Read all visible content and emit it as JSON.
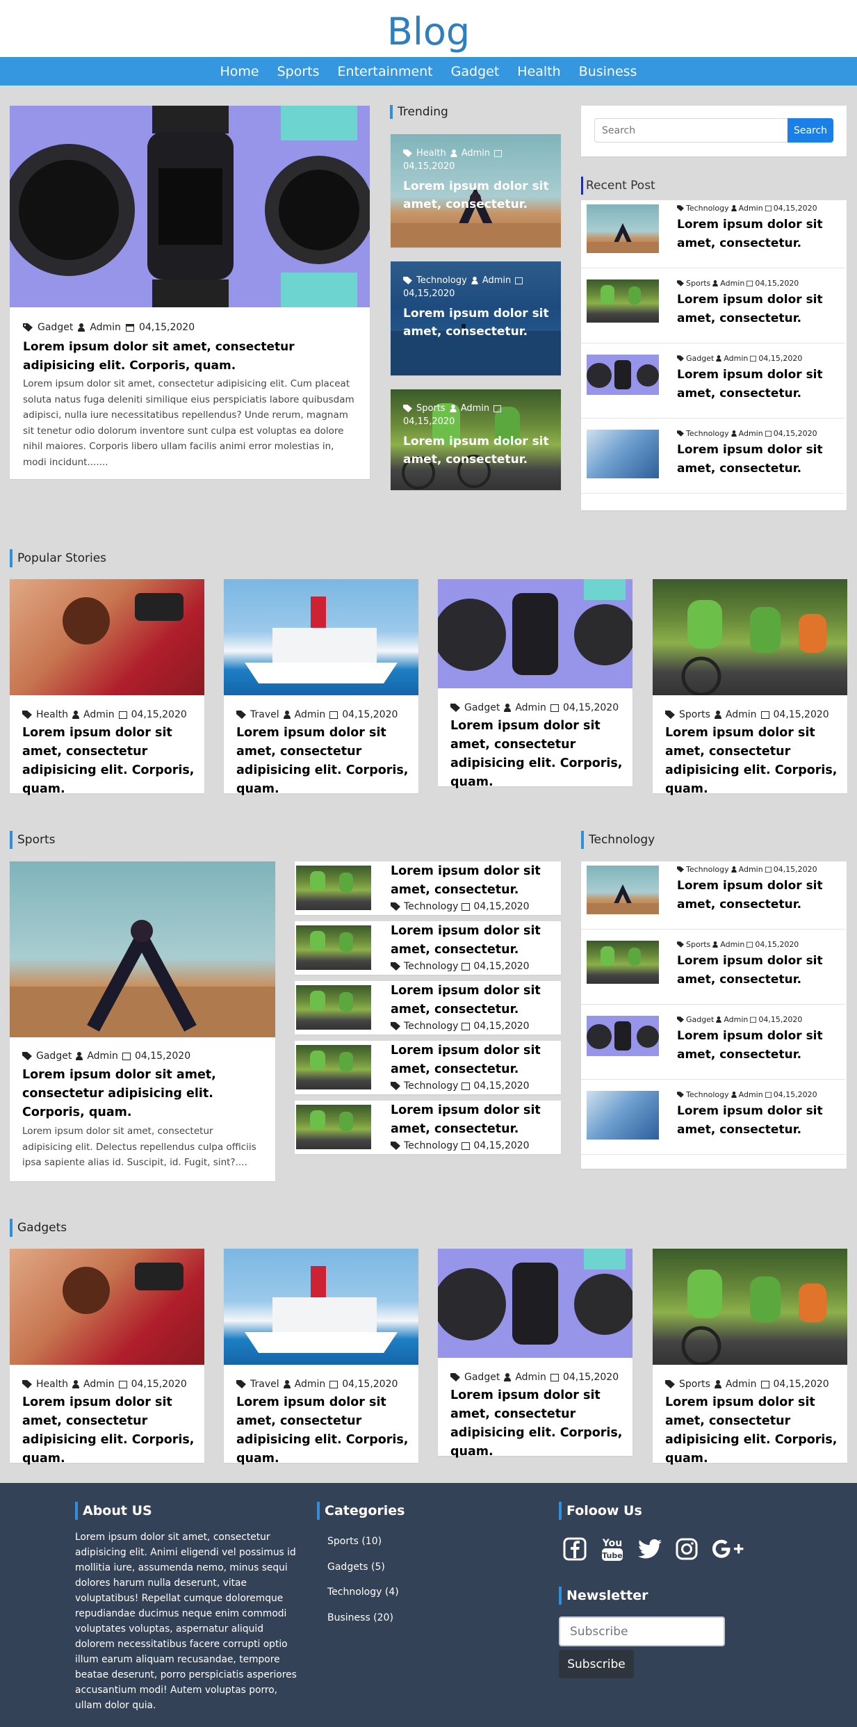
{
  "site_title": "Blog",
  "nav": [
    "Home",
    "Sports",
    "Entertainment",
    "Gadget",
    "Health",
    "Business"
  ],
  "featured": {
    "category": "Gadget",
    "author": "Admin",
    "date": "04,15,2020",
    "title": "Lorem ipsum dolor sit amet, consectetur adipisicing elit. Corporis, quam.",
    "body": "Lorem ipsum dolor sit amet, consectetur adipisicing elit. Cum placeat soluta natus fuga deleniti similique eius perspiciatis labore quibusdam adipisci, nulla iure necessitatibus repellendus? Unde rerum, magnam sit tenetur odio dolorum inventore sunt culpa est voluptas ea dolore nihil maiores. Corporis libero ullam facilis animi error molestias in, modi incidunt......."
  },
  "trending": {
    "heading": "Trending",
    "items": [
      {
        "category": "Health",
        "author": "Admin",
        "date": "04,15,2020",
        "title": "Lorem ipsum dolor sit amet, consectetur."
      },
      {
        "category": "Technology",
        "author": "Admin",
        "date": "04,15,2020",
        "title": "Lorem ipsum dolor sit amet, consectetur."
      },
      {
        "category": "Sports",
        "author": "Admin",
        "date": "04,15,2020",
        "title": "Lorem ipsum dolor sit amet, consectetur."
      }
    ]
  },
  "search": {
    "placeholder": "Search",
    "button": "Search"
  },
  "recent": {
    "heading": "Recent Post",
    "items": [
      {
        "category": "Technology",
        "author": "Admin",
        "date": "04,15,2020",
        "title": "Lorem ipsum dolor sit amet, consectetur."
      },
      {
        "category": "Sports",
        "author": "Admin",
        "date": "04,15,2020",
        "title": "Lorem ipsum dolor sit amet, consectetur."
      },
      {
        "category": "Gadget",
        "author": "Admin",
        "date": "04,15,2020",
        "title": "Lorem ipsum dolor sit amet, consectetur."
      },
      {
        "category": "Technology",
        "author": "Admin",
        "date": "04,15,2020",
        "title": "Lorem ipsum dolor sit amet, consectetur."
      }
    ]
  },
  "popular": {
    "heading": "Popular Stories",
    "items": [
      {
        "category": "Health",
        "author": "Admin",
        "date": "04,15,2020",
        "title": "Lorem ipsum dolor sit amet, consectetur adipisicing elit. Corporis, quam."
      },
      {
        "category": "Travel",
        "author": "Admin",
        "date": "04,15,2020",
        "title": "Lorem ipsum dolor sit amet, consectetur adipisicing elit. Corporis, quam."
      },
      {
        "category": "Gadget",
        "author": "Admin",
        "date": "04,15,2020",
        "title": "Lorem ipsum dolor sit amet, consectetur adipisicing elit. Corporis, quam."
      },
      {
        "category": "Sports",
        "author": "Admin",
        "date": "04,15,2020",
        "title": "Lorem ipsum dolor sit amet, consectetur adipisicing elit. Corporis, quam."
      }
    ]
  },
  "sports": {
    "heading": "Sports",
    "main": {
      "category": "Gadget",
      "author": "Admin",
      "date": "04,15,2020",
      "title": "Lorem ipsum dolor sit amet, consectetur adipisicing elit. Corporis, quam.",
      "body": "Lorem ipsum dolor sit amet, consectetur adipisicing elit. Delectus repellendus culpa officiis ipsa sapiente alias id. Suscipit, id. Fugit, sint?...."
    },
    "list": [
      {
        "category": "Technology",
        "date": "04,15,2020",
        "title": "Lorem ipsum dolor sit amet, consectetur."
      },
      {
        "category": "Technology",
        "date": "04,15,2020",
        "title": "Lorem ipsum dolor sit amet, consectetur."
      },
      {
        "category": "Technology",
        "date": "04,15,2020",
        "title": "Lorem ipsum dolor sit amet, consectetur."
      },
      {
        "category": "Technology",
        "date": "04,15,2020",
        "title": "Lorem ipsum dolor sit amet, consectetur."
      },
      {
        "category": "Technology",
        "date": "04,15,2020",
        "title": "Lorem ipsum dolor sit amet, consectetur."
      }
    ]
  },
  "technology": {
    "heading": "Technology",
    "items": [
      {
        "category": "Technology",
        "author": "Admin",
        "date": "04,15,2020",
        "title": "Lorem ipsum dolor sit amet, consectetur."
      },
      {
        "category": "Sports",
        "author": "Admin",
        "date": "04,15,2020",
        "title": "Lorem ipsum dolor sit amet, consectetur."
      },
      {
        "category": "Gadget",
        "author": "Admin",
        "date": "04,15,2020",
        "title": "Lorem ipsum dolor sit amet, consectetur."
      },
      {
        "category": "Technology",
        "author": "Admin",
        "date": "04,15,2020",
        "title": "Lorem ipsum dolor sit amet, consectetur."
      }
    ]
  },
  "gadgets": {
    "heading": "Gadgets",
    "items": [
      {
        "category": "Health",
        "author": "Admin",
        "date": "04,15,2020",
        "title": "Lorem ipsum dolor sit amet, consectetur adipisicing elit. Corporis, quam."
      },
      {
        "category": "Travel",
        "author": "Admin",
        "date": "04,15,2020",
        "title": "Lorem ipsum dolor sit amet, consectetur adipisicing elit. Corporis, quam."
      },
      {
        "category": "Gadget",
        "author": "Admin",
        "date": "04,15,2020",
        "title": "Lorem ipsum dolor sit amet, consectetur adipisicing elit. Corporis, quam."
      },
      {
        "category": "Sports",
        "author": "Admin",
        "date": "04,15,2020",
        "title": "Lorem ipsum dolor sit amet, consectetur adipisicing elit. Corporis, quam."
      }
    ]
  },
  "footer": {
    "about_heading": "About US",
    "about_text": "Lorem ipsum dolor sit amet, consectetur adipisicing elit. Animi eligendi vel possimus id mollitia iure, assumenda nemo, minus sequi dolores harum nulla deserunt, vitae voluptatibus! Repellat cumque doloremque repudiandae ducimus neque enim commodi voluptates voluptas, aspernatur aliquid dolorem necessitatibus facere corrupti optio illum earum aliquam recusandae, tempore beatae deserunt, porro perspiciatis asperiores accusantium modi! Autem voluptas porro, ullam dolor quia.",
    "categories_heading": "Categories",
    "categories": [
      "Sports (10)",
      "Gadgets (5)",
      "Technology (4)",
      "Business (20)"
    ],
    "follow_heading": "Foloow Us",
    "social_icons": [
      "facebook-icon",
      "youtube-icon",
      "twitter-icon",
      "instagram-icon",
      "google-plus-icon"
    ],
    "newsletter_heading": "Newsletter",
    "subscribe_placeholder": "Subscribe",
    "subscribe_button": "Subscribe"
  },
  "colors": {
    "accent": "#2e8fdc",
    "nav_bg": "#3597e0",
    "title": "#2e7fbf",
    "footer_bg": "#334257",
    "page_bg": "#dadada",
    "search_btn": "#1a7fe6"
  }
}
